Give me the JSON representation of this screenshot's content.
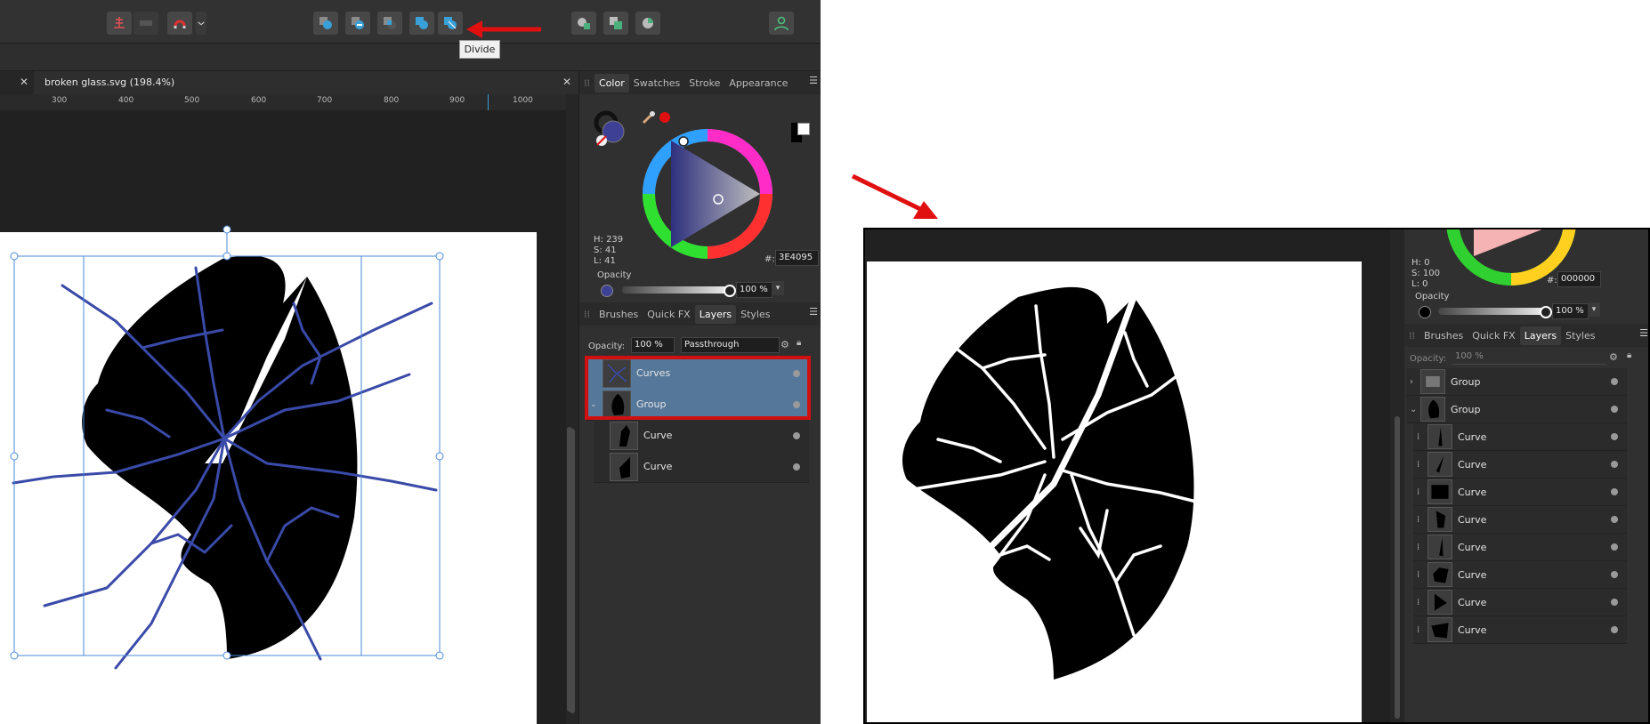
{
  "toolbar": {
    "buttons": [
      "snap-grid-icon",
      "toggle-icon",
      "magnet-icon",
      "chevron-down-icon",
      "add-icon",
      "subtract-icon",
      "intersect-icon",
      "xor-icon",
      "divide-icon",
      "combine-icon",
      "duplicate-icon",
      "pie-icon",
      "user-icon"
    ]
  },
  "tooltip": {
    "text": "Divide"
  },
  "document": {
    "tab_title": "broken glass.svg (198.4%)"
  },
  "ruler": {
    "ticks": [
      "300",
      "400",
      "500",
      "600",
      "700",
      "800",
      "900",
      "1000"
    ]
  },
  "color_panel": {
    "tabs": [
      "Color",
      "Swatches",
      "Stroke",
      "Appearance"
    ],
    "active_tab": "Color",
    "h": "H: 239",
    "s": "S: 41",
    "l": "L: 41",
    "hex_label": "#:",
    "hex_value": "3E4095",
    "opacity_label": "Opacity",
    "opacity_value": "100 %",
    "current_color": "#3E4095"
  },
  "layers_panel": {
    "tabs": [
      "Brushes",
      "Quick FX",
      "Layers",
      "Styles"
    ],
    "active_tab": "Layers",
    "opacity_label": "Opacity:",
    "opacity_value": "100 %",
    "blend_mode": "Passthrough",
    "rows": [
      {
        "name": "Curves",
        "selected": true
      },
      {
        "name": "Group",
        "selected": true
      },
      {
        "name": "Curve",
        "selected": false
      },
      {
        "name": "Curve",
        "selected": false
      }
    ]
  },
  "right_panel": {
    "h": "H: 0",
    "s": "S: 100",
    "l": "L: 0",
    "hex_label": "#:",
    "hex_value": "000000",
    "opacity_label": "Opacity",
    "opacity_value": "100 %",
    "tabs": [
      "Brushes",
      "Quick FX",
      "Layers",
      "Styles"
    ],
    "active_tab": "Layers",
    "layer_opacity_label": "Opacity:",
    "layer_opacity_value": "100 %",
    "rows": [
      "Group",
      "Group",
      "Curve",
      "Curve",
      "Curve",
      "Curve",
      "Curve",
      "Curve",
      "Curve",
      "Curve"
    ]
  },
  "colors": {
    "annotation_red": "#e01010",
    "selection_blue": "#55779a",
    "crack_blue": "#3a4aa8"
  }
}
